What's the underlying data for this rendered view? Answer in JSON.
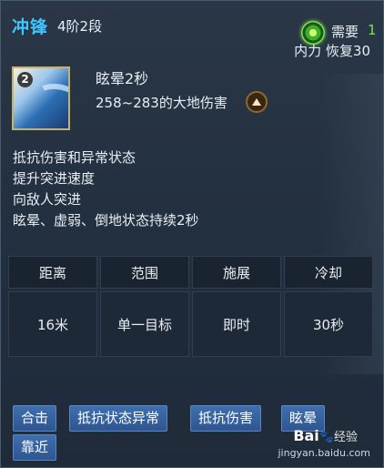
{
  "skill": {
    "name": "冲锋",
    "rank": "4阶2段",
    "icon_badge": "2"
  },
  "cost": {
    "label": "需要",
    "value": "1",
    "regen": "内力 恢复30"
  },
  "effect": {
    "title": "眩晕2秒",
    "damage": "258~283的大地伤害"
  },
  "description": [
    "抵抗伤害和异常状态",
    "提升突进速度",
    "向敌人突进",
    "眩晕、虚弱、倒地状态持续2秒"
  ],
  "stats": {
    "headers": [
      "距离",
      "范围",
      "施展",
      "冷却"
    ],
    "values": [
      "16米",
      "单一目标",
      "即时",
      "30秒"
    ]
  },
  "tags": [
    "合击",
    "抵抗状态异常",
    "抵抗伤害",
    "眩晕",
    "靠近"
  ],
  "watermark": {
    "brand": "Bai",
    "brand2": "经验",
    "url": "jingyan.baidu.com"
  },
  "colors": {
    "skill_name": "#3ec6ff",
    "cost_value": "#7fe04f",
    "tag_bg": "#3e6fae",
    "panel_bg": "#233040"
  }
}
